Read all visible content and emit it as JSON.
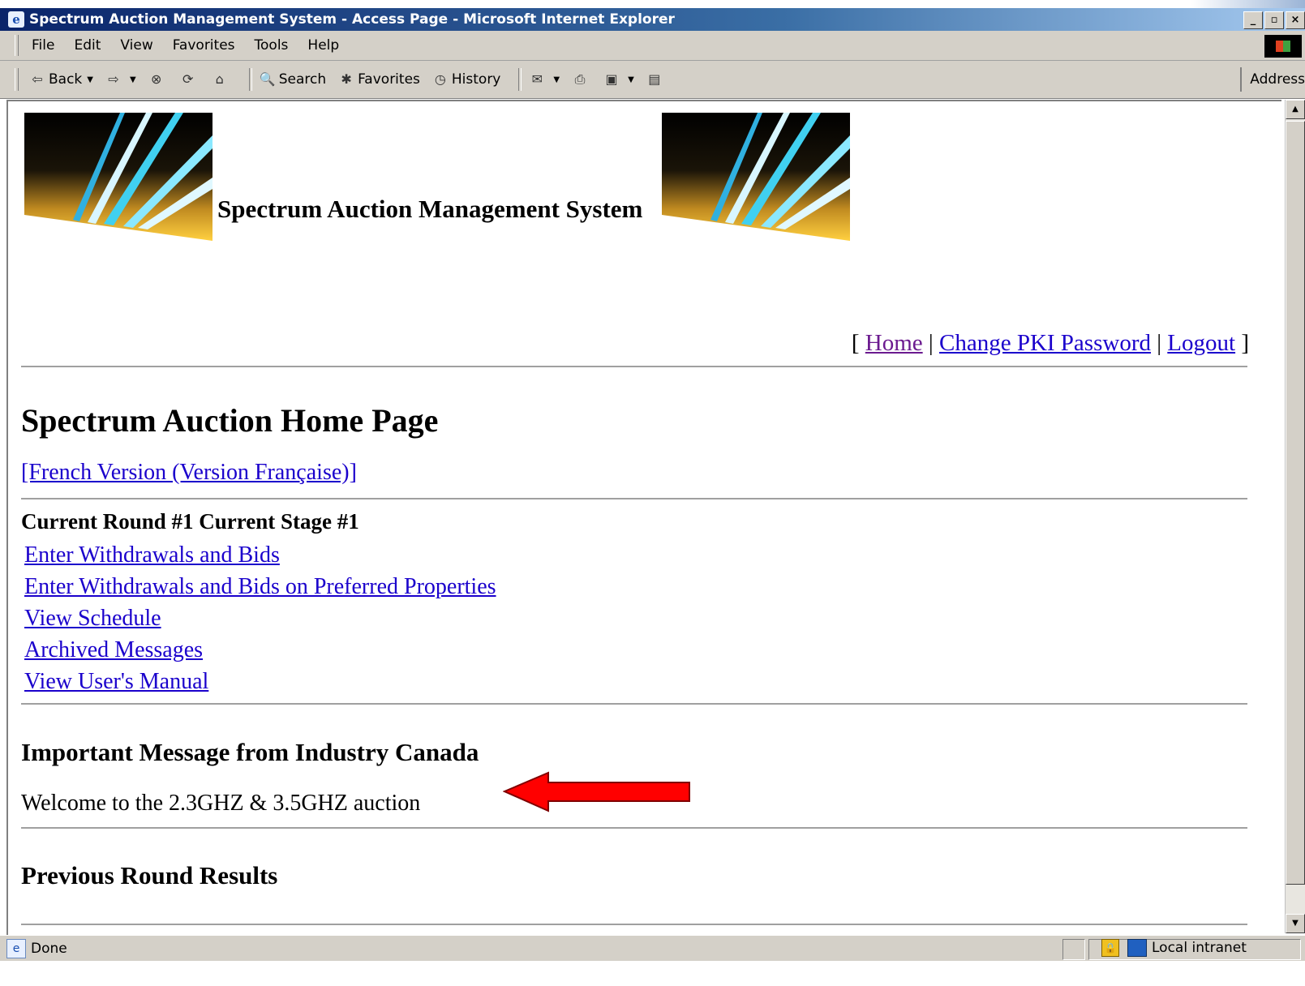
{
  "window": {
    "title": "Spectrum Auction Management System - Access Page - Microsoft Internet Explorer",
    "buttons": [
      "_",
      "▫",
      "×"
    ]
  },
  "menu": {
    "items": [
      "File",
      "Edit",
      "View",
      "Favorites",
      "Tools",
      "Help"
    ]
  },
  "toolbar": {
    "back_label": "Back",
    "search_label": "Search",
    "favorites_label": "Favorites",
    "history_label": "History",
    "address_label": "Address"
  },
  "page": {
    "banner_title": "Spectrum Auction Management System",
    "nav": {
      "open": "[",
      "home": "Home",
      "sep1": "|",
      "change_password": "Change PKI Password",
      "sep2": "|",
      "logout": "Logout",
      "close": "]"
    },
    "heading": "Spectrum Auction Home Page",
    "french_link": "[French Version (Version Française)]",
    "round_status": "Current Round #1 Current Stage #1",
    "links": [
      "Enter Withdrawals and Bids",
      "Enter Withdrawals and Bids on Preferred Properties",
      "View Schedule",
      "Archived Messages",
      "View User's Manual"
    ],
    "important_heading": "Important Message from Industry Canada",
    "important_message": "Welcome to the 2.3GHZ & 3.5GHZ auction",
    "previous_heading": "Previous Round Results"
  },
  "status": {
    "text": "Done",
    "zone": "Local intranet"
  },
  "colors": {
    "link": "#1a00cc",
    "visited_link": "#6b1a8f",
    "arrow": "#ff0000"
  },
  "icons": [
    "ie-icon",
    "back-icon",
    "forward-icon",
    "stop-icon",
    "refresh-icon",
    "home-icon",
    "search-icon",
    "favorites-icon",
    "history-icon",
    "mail-icon",
    "print-icon",
    "edit-icon",
    "discuss-icon",
    "lock-icon",
    "intranet-icon",
    "windows-logo-icon"
  ]
}
